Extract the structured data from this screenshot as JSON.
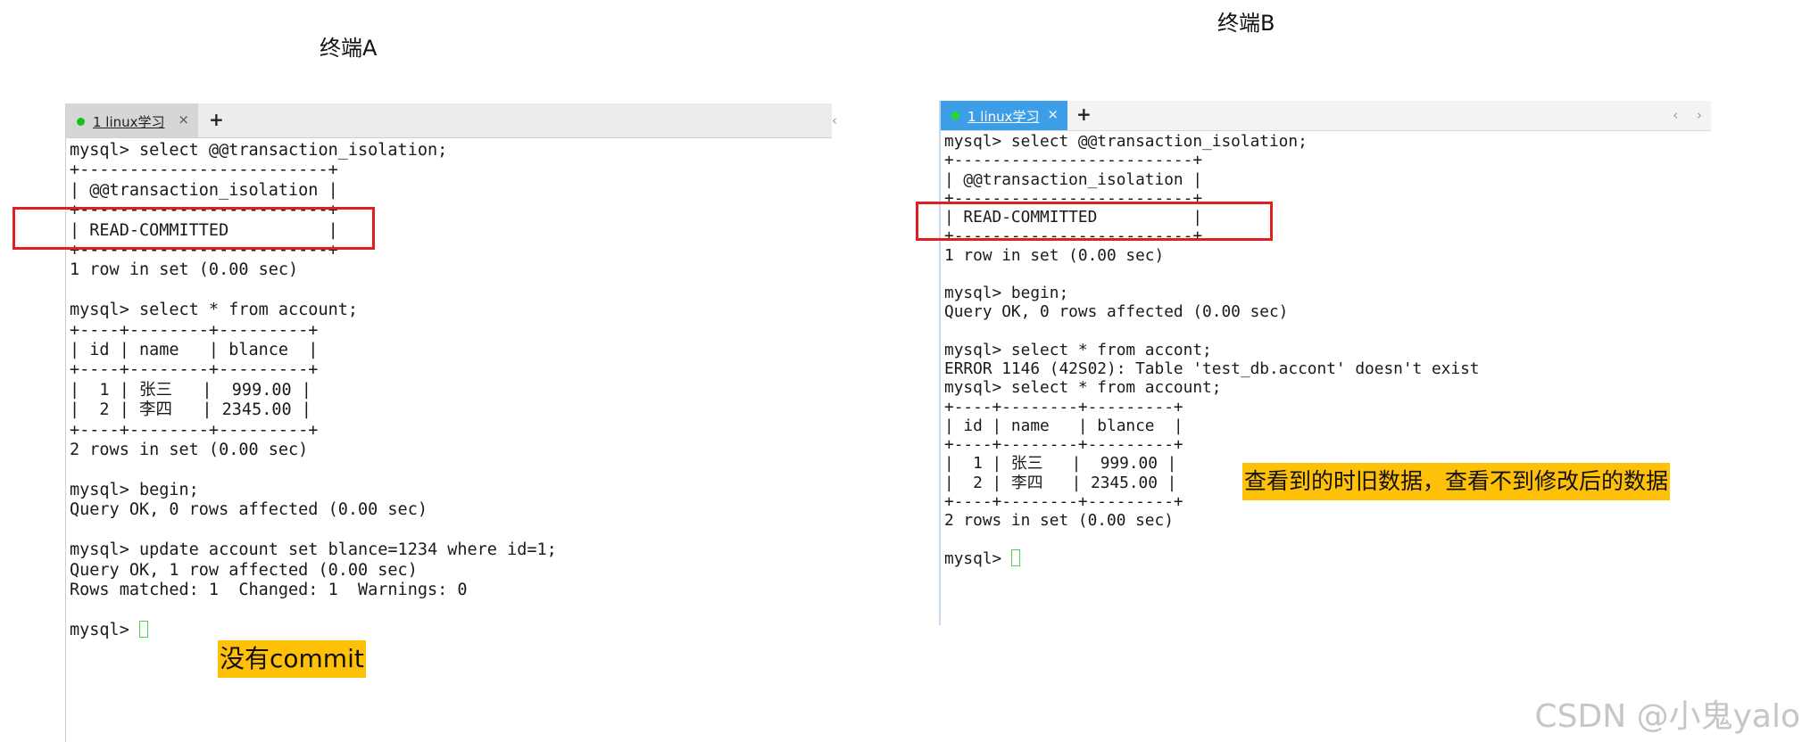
{
  "labels": {
    "terminal_a_title": "终端A",
    "terminal_b_title": "终端B"
  },
  "terminal_a": {
    "tab_label": "1 linux学习",
    "tab_close": "×",
    "tab_add": "+",
    "scroll_arrows": "‹",
    "status_indicator_color": "#18c018",
    "lines": [
      "mysql> select @@transaction_isolation;",
      "+-------------------------+",
      "| @@transaction_isolation |",
      "+-------------------------+",
      "| READ-COMMITTED          |",
      "+-------------------------+",
      "1 row in set (0.00 sec)",
      "",
      "mysql> select * from account;",
      "+----+--------+---------+",
      "| id | name   | blance  |",
      "+----+--------+---------+",
      "|  1 | 张三   |  999.00 |",
      "|  2 | 李四   | 2345.00 |",
      "+----+--------+---------+",
      "2 rows in set (0.00 sec)",
      "",
      "mysql> begin;",
      "Query OK, 0 rows affected (0.00 sec)",
      "",
      "mysql> update account set blance=1234 where id=1;",
      "Query OK, 1 row affected (0.00 sec)",
      "Rows matched: 1  Changed: 1  Warnings: 0",
      ""
    ],
    "prompt": "mysql> "
  },
  "terminal_b": {
    "tab_label": "1 linux学习",
    "tab_close": "×",
    "tab_add": "+",
    "scroll_arrows": "‹ ›",
    "tab_active_color": "#3d9ee8",
    "lines": [
      "mysql> select @@transaction_isolation;",
      "+-------------------------+",
      "| @@transaction_isolation |",
      "+-------------------------+",
      "| READ-COMMITTED          |",
      "+-------------------------+",
      "1 row in set (0.00 sec)",
      "",
      "mysql> begin;",
      "Query OK, 0 rows affected (0.00 sec)",
      "",
      "mysql> select * from accont;",
      "ERROR 1146 (42S02): Table 'test_db.accont' doesn't exist",
      "mysql> select * from account;",
      "+----+--------+---------+",
      "| id | name   | blance  |",
      "+----+--------+---------+",
      "|  1 | 张三   |  999.00 |",
      "|  2 | 李四   | 2345.00 |",
      "+----+--------+---------+",
      "2 rows in set (0.00 sec)",
      ""
    ],
    "prompt": "mysql> "
  },
  "annotations": {
    "note_a": "没有commit",
    "note_b": "查看到的时旧数据，查看不到修改后的数据",
    "highlight_color": "#e0201e",
    "note_color": "#ffc107"
  },
  "watermark": "CSDN @小鬼yalo"
}
